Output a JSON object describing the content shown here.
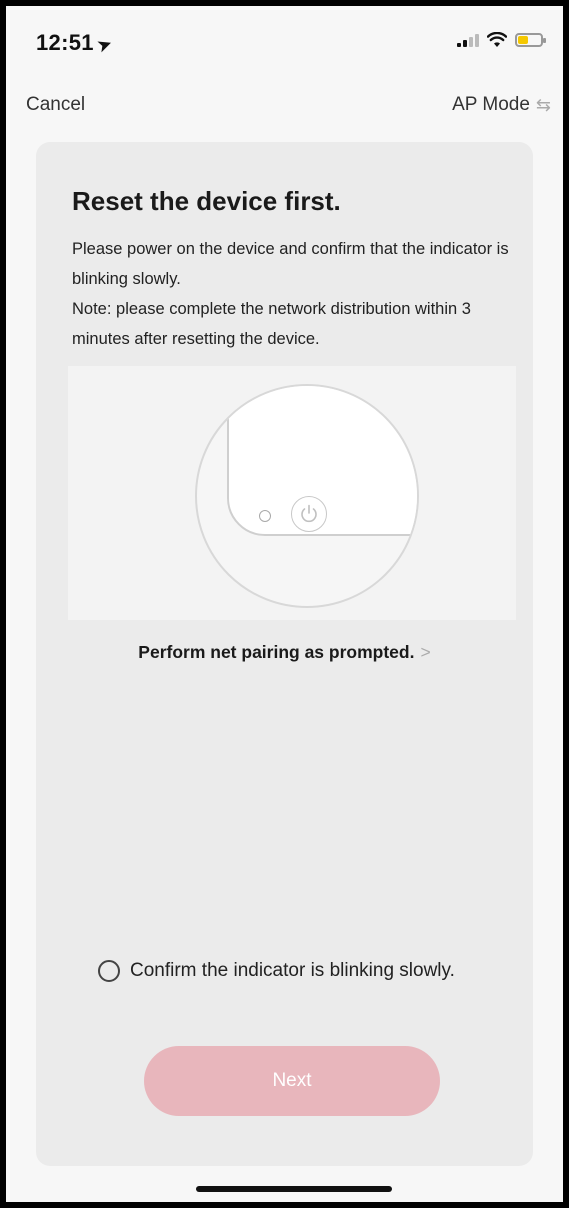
{
  "status_bar": {
    "time": "12:51",
    "location_icon": "location-arrow-icon",
    "signal_icon": "cellular-signal-icon",
    "wifi_icon": "wifi-icon",
    "battery_icon": "battery-icon",
    "battery_color": "#f5c800"
  },
  "nav": {
    "cancel_label": "Cancel",
    "mode_label": "AP Mode",
    "mode_icon": "switch-arrows-icon"
  },
  "card": {
    "title": "Reset the device first.",
    "description": "Please power on the device and confirm that the indicator is blinking slowly.",
    "note": "Note: please complete the network distribution within 3 minutes after resetting the device.",
    "prompt_link": "Perform net pairing as prompted.",
    "prompt_icon": "chevron-right-icon",
    "confirm_label": "Confirm the indicator is blinking slowly.",
    "confirm_checked": false,
    "next_label": "Next",
    "next_color": "#e8b6bc"
  }
}
